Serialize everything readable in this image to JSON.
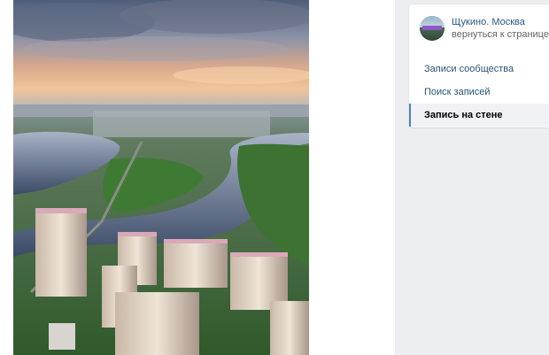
{
  "post": {
    "image_alt": "aerial city panorama"
  },
  "nav": {
    "community_name": "Щукино. Москва",
    "back_link": "вернуться к странице",
    "items": [
      {
        "label": "Записи сообщества",
        "active": false
      },
      {
        "label": "Поиск записей",
        "active": false
      },
      {
        "label": "Запись на стене",
        "active": true
      }
    ]
  },
  "colors": {
    "page_bg": "#edeef0",
    "link": "#2a5885",
    "active_marker": "#5181b8"
  }
}
